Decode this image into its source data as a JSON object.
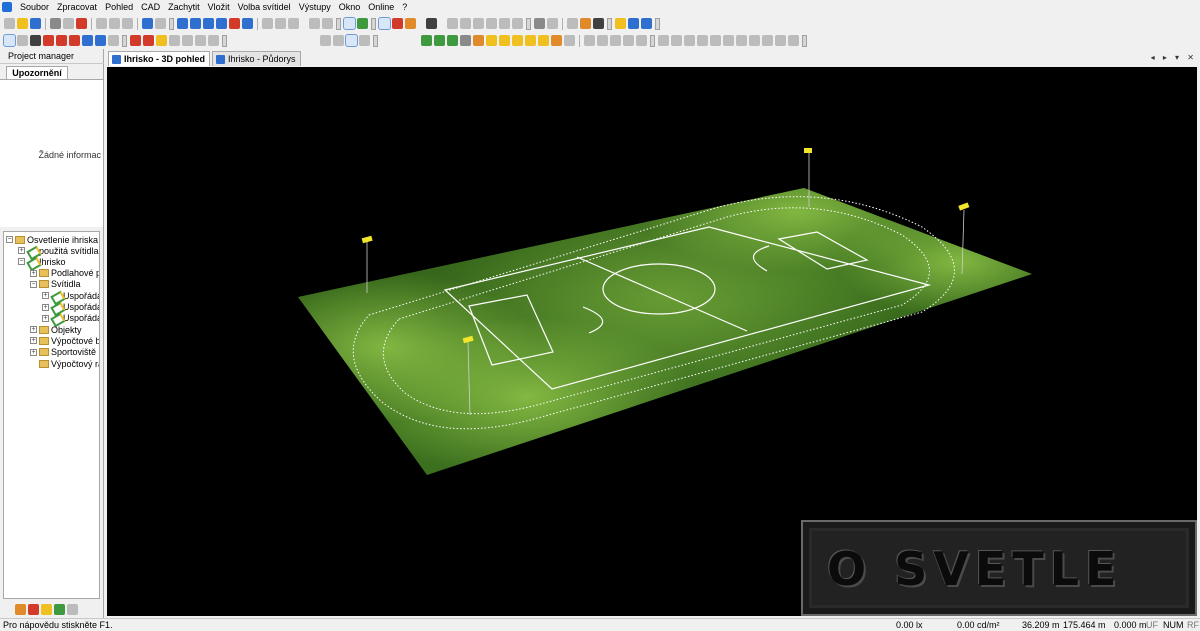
{
  "menu": [
    "Soubor",
    "Zpracovat",
    "Pohled",
    "CAD",
    "Zachytit",
    "Vložit",
    "Volba svítidel",
    "Výstupy",
    "Okno",
    "Online",
    "?"
  ],
  "project_manager": {
    "title": "Project manager",
    "tab": "Upozornění",
    "empty_text": "Žádné informac"
  },
  "tree": {
    "root": "Osvetlenie ihriska",
    "items": [
      {
        "label": "použitá svítidla",
        "level": 1,
        "icon": "luminaire-icon",
        "expander": "+"
      },
      {
        "label": "Ihrisko",
        "level": 1,
        "icon": "field-icon",
        "expander": "−"
      },
      {
        "label": "Podlahové pr",
        "level": 2,
        "icon": "folder-icon",
        "expander": "+"
      },
      {
        "label": "Svítidla",
        "level": 2,
        "icon": "folder-icon",
        "expander": "−"
      },
      {
        "label": "Uspořádán",
        "level": 3,
        "icon": "luminaire-icon",
        "expander": "+"
      },
      {
        "label": "Uspořádán",
        "level": 3,
        "icon": "luminaire-icon",
        "expander": "+"
      },
      {
        "label": "Uspořádán",
        "level": 3,
        "icon": "luminaire-icon",
        "expander": "+"
      },
      {
        "label": "Objekty",
        "level": 2,
        "icon": "folder-icon",
        "expander": "+"
      },
      {
        "label": "Výpočtové bo",
        "level": 2,
        "icon": "folder-icon",
        "expander": "+"
      },
      {
        "label": "Sportoviště",
        "level": 2,
        "icon": "folder-icon",
        "expander": "+"
      },
      {
        "label": "Výpočtový ras",
        "level": 2,
        "icon": "folder-icon",
        "expander": ""
      }
    ]
  },
  "tabs": [
    {
      "label": "Ihrisko - 3D pohled",
      "active": true,
      "icon": "3d-view-icon"
    },
    {
      "label": "Ihrisko - Půdorys",
      "active": false,
      "icon": "plan-view-icon"
    }
  ],
  "tab_controls": "◂ ▸ ▾ ✕",
  "watermark": "O SVETLE",
  "status": {
    "help": "Pro nápovědu stiskněte F1.",
    "illuminance": "0.00 lx",
    "luminance": "0.00 cd/m²",
    "x": "36.209 m",
    "y": "175.464 m",
    "z": "0.000 m",
    "uf": "UF",
    "num": "NUM",
    "rf": "RF"
  },
  "colors": {
    "field": "#3c6e1f",
    "field_lit": "#8fc448",
    "lines": "#ffffff",
    "pole_head": "#f2e62a",
    "viewport_bg": "#000000"
  }
}
